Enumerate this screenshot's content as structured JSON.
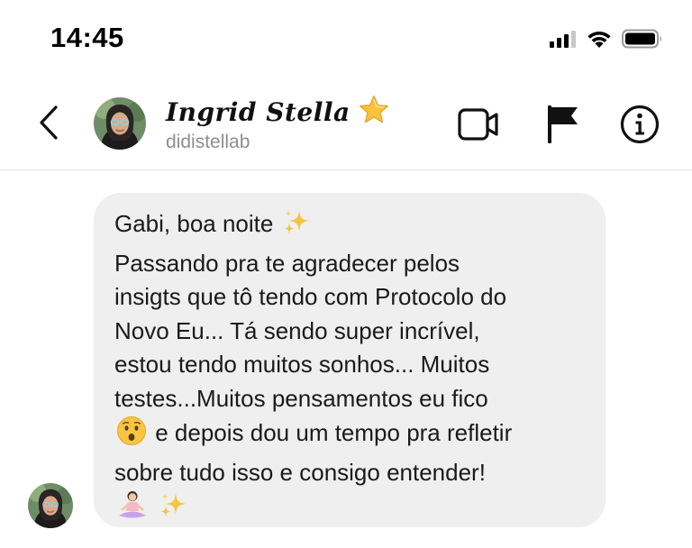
{
  "status_bar": {
    "time": "14:45",
    "icons": [
      "cellular-signal-icon",
      "wifi-icon",
      "battery-icon"
    ]
  },
  "header": {
    "back_icon": "chevron-left-icon",
    "contact_name": "Ingrid Stella",
    "name_badge_icon": "star-emoji-icon",
    "username": "didistellab",
    "actions": [
      "video-camera-icon",
      "flag-icon",
      "info-icon"
    ]
  },
  "message": {
    "lines": [
      "Gabi, boa noite",
      "Passando pra te agradecer pelos",
      "insigts que tô tendo com Protocolo do",
      "Novo Eu... Tá sendo super incrível,",
      "estou tendo muitos sonhos... Muitos",
      "testes...Muitos pensamentos eu fico",
      "e depois dou um tempo pra refletir",
      "sobre tudo isso e consigo entender!"
    ],
    "emojis": [
      "sparkles-emoji-icon",
      "hushed-face-emoji-icon",
      "person-in-lotus-position-emoji-icon",
      "sparkles-emoji-icon"
    ]
  },
  "colors": {
    "bubble_background": "#efefef",
    "secondary_text": "#8e8e8e",
    "divider": "#e4e4e4",
    "star": "#f7c23c",
    "sparkles": "#f4c542"
  }
}
